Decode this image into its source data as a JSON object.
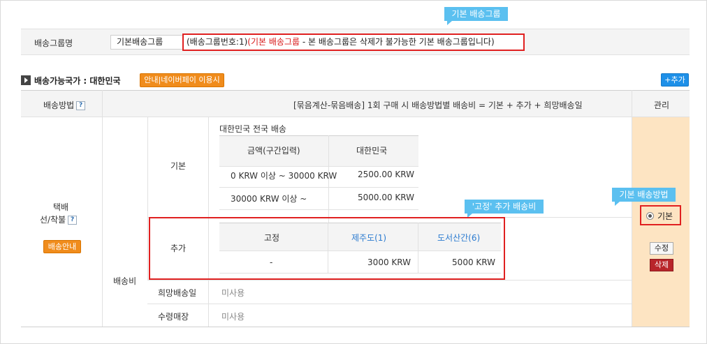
{
  "callouts": {
    "default_group": "기본 배송그룹",
    "fixed_extra": "'고정' 추가 배송비",
    "default_method": "기본 배송방법"
  },
  "group": {
    "label": "배송그룹명",
    "name_value": "기본배송그룹",
    "note_prefix": "(배송그룹번호:1)",
    "note_red": "(기본 배송그룹",
    "note_suffix": " - 본 배송그룹은 삭제가 불가능한 기본 배송그룹입니다)"
  },
  "section": {
    "title": "배송가능국가 : 대한민국",
    "guide_button": "안내|네이버페이 이용시",
    "add_button": "+추가"
  },
  "header": {
    "method": "배송방법",
    "help": "?",
    "formula": "[묶음계산-묶음배송] 1회 구매 시 배송방법별 배송비 = 기본 + 추가 + 희망배송일",
    "manage": "관리"
  },
  "method": {
    "name_line1": "택배",
    "name_line2": "선/착불",
    "help": "?",
    "guide_button": "배송안내",
    "fee_label": "배송비"
  },
  "basic": {
    "label": "기본",
    "title": "대한민국 전국 배송",
    "columns": [
      "금액(구간입력)",
      "대한민국"
    ],
    "rows": [
      [
        "0 KRW 이상 ~ 30000 KRW",
        "2500.00 KRW"
      ],
      [
        "30000 KRW 이상 ~",
        "5000.00 KRW"
      ]
    ]
  },
  "extra": {
    "label": "추가",
    "columns": [
      "고정",
      "제주도(1)",
      "도서산간(6)"
    ],
    "row": [
      "-",
      "3000 KRW",
      "5000 KRW"
    ]
  },
  "wish_day": {
    "label": "희망배송일",
    "value": "미사용"
  },
  "pickup": {
    "label": "수령매장",
    "value": "미사용"
  },
  "manage": {
    "radio_label": "기본",
    "edit_button": "수정",
    "delete_button": "삭제"
  },
  "colors": {
    "callout": "#5bc0f0",
    "highlight_red": "#e02020",
    "manage_bg": "#fde4c2",
    "orange_button": "#f08c1c",
    "blue_button": "#1e90e8",
    "delete_button": "#b8252a",
    "link_blue": "#2b7bd0"
  }
}
